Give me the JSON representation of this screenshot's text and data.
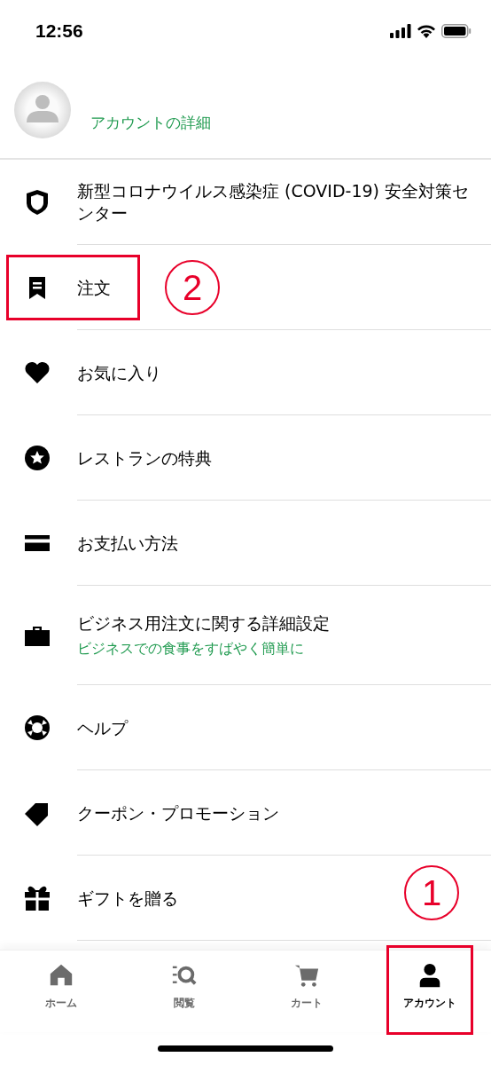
{
  "status_bar": {
    "time": "12:56"
  },
  "profile": {
    "link": "アカウントの詳細"
  },
  "menu": [
    {
      "label": "新型コロナウイルス感染症 (COVID-19) 安全対策センター",
      "highlighted": false
    },
    {
      "label": "注文",
      "highlighted": true,
      "callout": "2"
    },
    {
      "label": "お気に入り",
      "highlighted": false
    },
    {
      "label": "レストランの特典",
      "highlighted": false
    },
    {
      "label": "お支払い方法",
      "highlighted": false
    },
    {
      "label": "ビジネス用注文に関する詳細設定",
      "subtitle": "ビジネスでの食事をすばやく簡単に",
      "highlighted": false
    },
    {
      "label": "ヘルプ",
      "highlighted": false
    },
    {
      "label": "クーポン・プロモーション",
      "highlighted": false
    },
    {
      "label": "ギフトを贈る",
      "highlighted": false
    }
  ],
  "tab_bar": [
    {
      "label": "ホーム",
      "selected": false,
      "highlighted": false
    },
    {
      "label": "閲覧",
      "selected": false,
      "highlighted": false
    },
    {
      "label": "カート",
      "selected": false,
      "highlighted": false
    },
    {
      "label": "アカウント",
      "selected": true,
      "highlighted": true,
      "callout": "1"
    }
  ]
}
